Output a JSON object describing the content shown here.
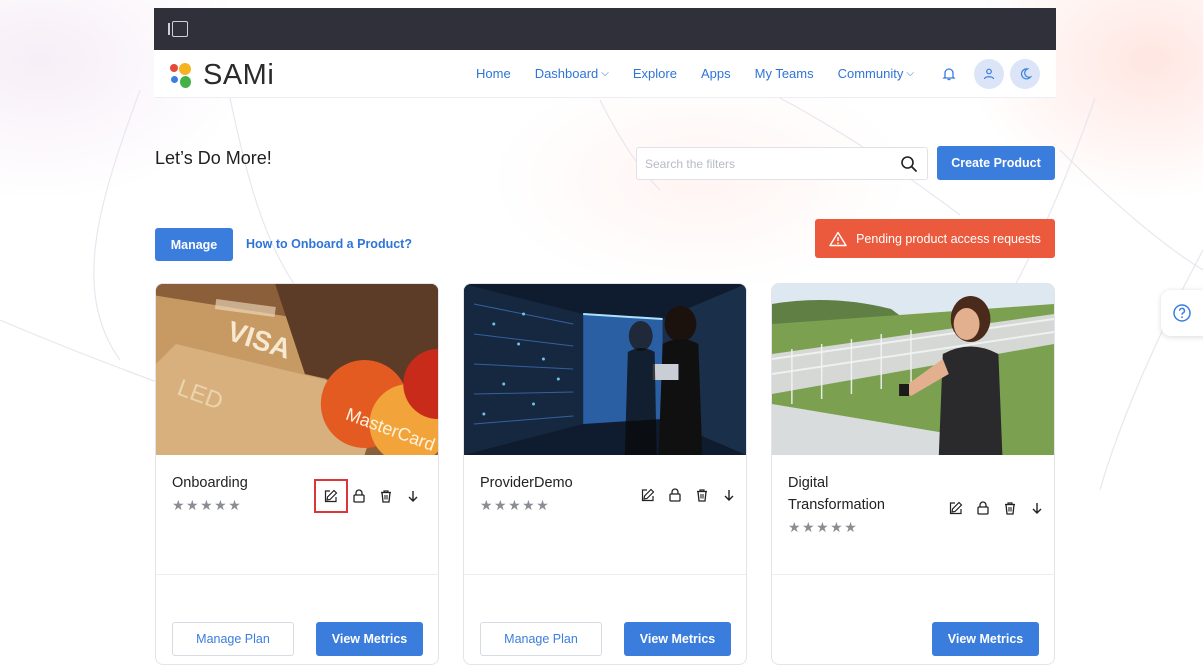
{
  "app": {
    "name": "SAMi",
    "colors": {
      "accent": "#3b7ddd",
      "warning": "#ec5a3d",
      "topbar": "#2f3039"
    }
  },
  "topbar": {
    "sidebar_toggle_icon": "sidebar-toggle-icon"
  },
  "nav": {
    "links": [
      {
        "label": "Home",
        "dropdown": false
      },
      {
        "label": "Dashboard",
        "dropdown": true
      },
      {
        "label": "Explore",
        "dropdown": false
      },
      {
        "label": "Apps",
        "dropdown": false
      },
      {
        "label": "My Teams",
        "dropdown": false
      },
      {
        "label": "Community",
        "dropdown": true
      }
    ],
    "icons": [
      "bell-icon",
      "user-icon",
      "moon-icon"
    ]
  },
  "page": {
    "title": "Let’s Do More!",
    "search": {
      "placeholder": "Search the filters",
      "value": ""
    },
    "create_button": "Create Product",
    "manage_button": "Manage",
    "onboard_link": "How to Onboard a Product?",
    "pending_button": "Pending product access requests"
  },
  "cards": [
    {
      "title": "Onboarding",
      "image": "credit-cards-photo",
      "rating": 0,
      "stars": "★★★★★",
      "manage_plan": "Manage Plan",
      "view_metrics": "View Metrics",
      "selected_action": "edit"
    },
    {
      "title": "ProviderDemo",
      "image": "server-room-photo",
      "rating": 0,
      "stars": "★★★★★",
      "manage_plan": "Manage Plan",
      "view_metrics": "View Metrics"
    },
    {
      "title": "Digital Transformation",
      "image": "runner-checking-watch-photo",
      "rating": 0,
      "stars": "★★★★★",
      "view_metrics": "View Metrics"
    }
  ],
  "card_actions": [
    "edit-icon",
    "lock-icon",
    "trash-icon",
    "arrow-down-icon"
  ],
  "help": {
    "icon": "help-icon"
  }
}
